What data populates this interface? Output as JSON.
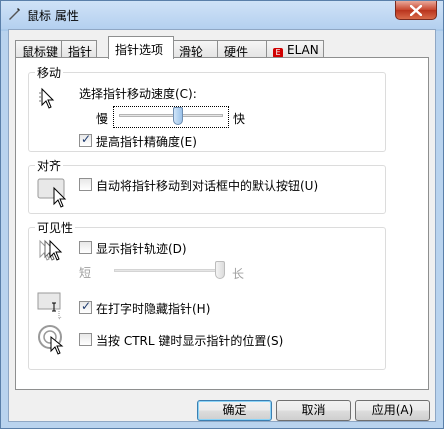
{
  "window": {
    "title": "鼠标 属性",
    "close_icon": "close-icon"
  },
  "tabs": [
    {
      "label": "鼠标键"
    },
    {
      "label": "指针"
    },
    {
      "label": "指针选项",
      "active": true
    },
    {
      "label": "滑轮"
    },
    {
      "label": "硬件"
    },
    {
      "label": "ELAN"
    }
  ],
  "motion": {
    "group_title": "移动",
    "speed_label": "选择指针移动速度(C):",
    "slow": "慢",
    "fast": "快",
    "speed_level": 0.57,
    "enhance_label": "提高指针精确度(E)",
    "enhance_checked": true
  },
  "snap": {
    "group_title": "对齐",
    "label": "自动将指针移动到对话框中的默认按钮(U)",
    "checked": false
  },
  "visibility": {
    "group_title": "可见性",
    "trails_label": "显示指针轨迹(D)",
    "trails_checked": false,
    "short": "短",
    "long": "长",
    "trail_level": 1.0,
    "hide_label": "在打字时隐藏指针(H)",
    "hide_checked": true,
    "ctrl_label": "当按 CTRL 键时显示指针的位置(S)",
    "ctrl_checked": false
  },
  "buttons": {
    "ok": "确定",
    "cancel": "取消",
    "apply": "应用(A)"
  },
  "colors": {
    "titlebar": "#b4d0ef",
    "close_button": "#c7452d",
    "slider_thumb": "#9cc3ea",
    "default_button_border": "#3c7fb1"
  }
}
